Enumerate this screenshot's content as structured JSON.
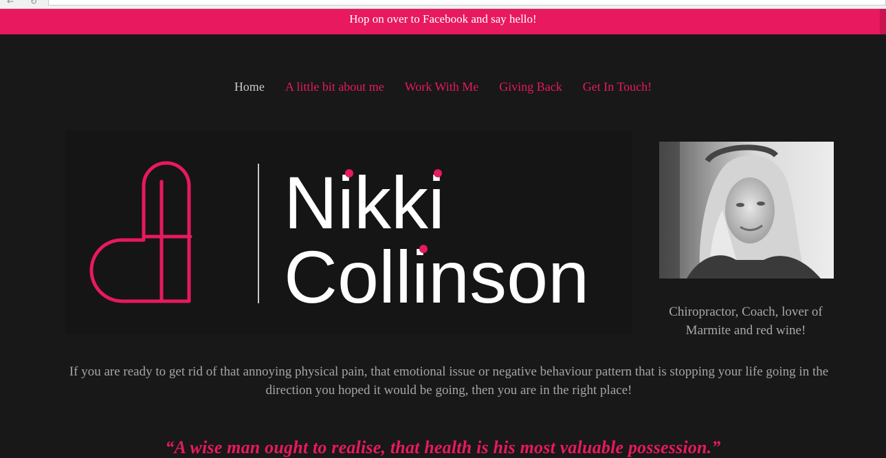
{
  "announcement": {
    "text": "Hop on over to Facebook and say hello!"
  },
  "nav": {
    "items": [
      {
        "label": "Home",
        "active": true
      },
      {
        "label": "A little bit about me",
        "active": false
      },
      {
        "label": "Work With Me",
        "active": false
      },
      {
        "label": "Giving Back",
        "active": false
      },
      {
        "label": "Get In Touch!",
        "active": false
      }
    ]
  },
  "logo": {
    "first_name": "Nikki",
    "last_name": "Collinson",
    "icon": "heart-cross-icon"
  },
  "profile": {
    "caption": "Chiropractor, Coach, lover of Marmite and red wine!"
  },
  "intro": {
    "text": "If you are ready to get rid of that annoying physical pain, that emotional issue or negative behaviour pattern that is stopping your life going in the direction you hoped it would be going, then you are in the right place!"
  },
  "quote": {
    "text": "“A wise man ought to realise, that health is his most valuable possession.”"
  },
  "colors": {
    "accent": "#e8195e",
    "background": "#181818",
    "text_muted": "#a5a5a5"
  }
}
